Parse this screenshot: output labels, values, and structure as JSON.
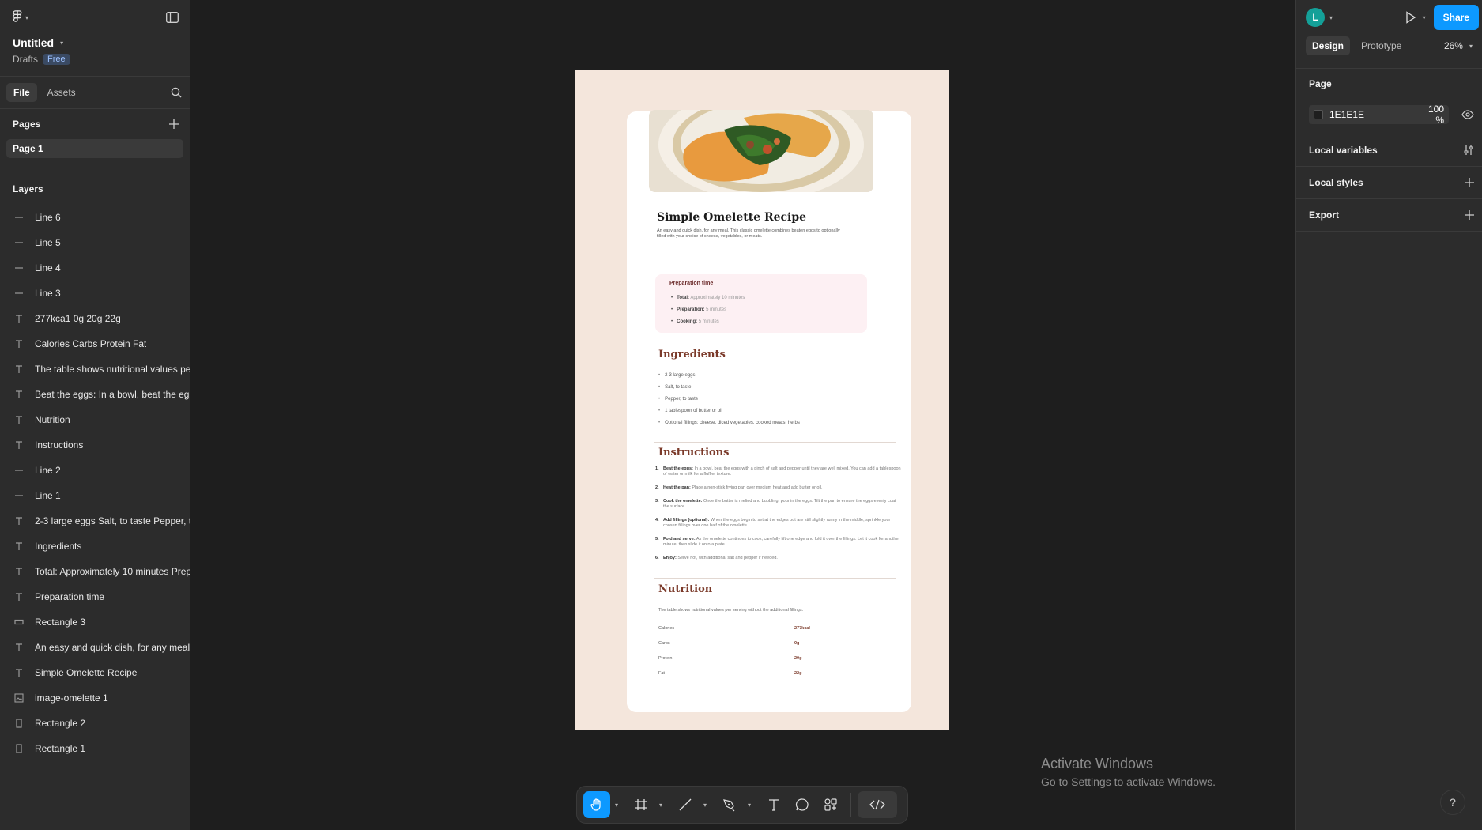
{
  "file": {
    "title": "Untitled",
    "location": "Drafts",
    "plan_badge": "Free"
  },
  "left_tabs": {
    "file": "File",
    "assets": "Assets"
  },
  "pages": {
    "heading": "Pages",
    "items": [
      "Page 1"
    ]
  },
  "layers": {
    "heading": "Layers",
    "items": [
      {
        "name": "Line 6",
        "icon": "line-icon"
      },
      {
        "name": "Line 5",
        "icon": "line-icon"
      },
      {
        "name": "Line 4",
        "icon": "line-icon"
      },
      {
        "name": "Line 3",
        "icon": "line-icon"
      },
      {
        "name": "277kca1 0g 20g 22g",
        "icon": "text-icon"
      },
      {
        "name": "Calories Carbs Protein Fat",
        "icon": "text-icon"
      },
      {
        "name": "The table shows nutritional values per",
        "icon": "text-icon"
      },
      {
        "name": "Beat the eggs: In a bowl, beat the egg",
        "icon": "text-icon"
      },
      {
        "name": "Nutrition",
        "icon": "text-icon"
      },
      {
        "name": "Instructions",
        "icon": "text-icon"
      },
      {
        "name": "Line 2",
        "icon": "line-icon"
      },
      {
        "name": "Line 1",
        "icon": "line-icon"
      },
      {
        "name": "2-3 large eggs Salt, to taste Pepper, to",
        "icon": "text-icon"
      },
      {
        "name": "Ingredients",
        "icon": "text-icon"
      },
      {
        "name": "Total: Approximately 10 minutes Prepa",
        "icon": "text-icon"
      },
      {
        "name": "Preparation time",
        "icon": "text-icon"
      },
      {
        "name": "Rectangle 3",
        "icon": "rectangle-icon"
      },
      {
        "name": "An easy and quick dish, for any meal. T",
        "icon": "text-icon"
      },
      {
        "name": "Simple Omelette Recipe",
        "icon": "text-icon"
      },
      {
        "name": "image-omelette 1",
        "icon": "image-icon"
      },
      {
        "name": "Rectangle 2",
        "icon": "frame-icon"
      },
      {
        "name": "Rectangle 1",
        "icon": "frame-icon"
      }
    ]
  },
  "right": {
    "avatar_initial": "L",
    "share_label": "Share",
    "tabs": {
      "design": "Design",
      "prototype": "Prototype"
    },
    "zoom": "26%",
    "page_heading": "Page",
    "page_color": {
      "hex": "1E1E1E",
      "opacity": "100",
      "unit": "%",
      "swatch": "#1e1e1e"
    },
    "local_variables": "Local variables",
    "local_styles": "Local styles",
    "export": "Export"
  },
  "recipe": {
    "title": "Simple Omelette Recipe",
    "intro": "An easy and quick dish, for any meal. This classic omelette combines beaten eggs to optionally filled with your choice of cheese, vegetables, or meats.",
    "prep": {
      "title": "Preparation time",
      "items": [
        {
          "label": "Total:",
          "value": "Approximately 10 minutes"
        },
        {
          "label": "Preparation:",
          "value": "5 minutes"
        },
        {
          "label": "Cooking:",
          "value": "5 minutes"
        }
      ]
    },
    "ingredients": {
      "title": "Ingredients",
      "items": [
        "2-3 large eggs",
        "Salt, to taste",
        "Pepper, to taste",
        "1 tablespoon of butter or oil",
        "Optional fillings: cheese, diced vegetables, cooked meats, herbs"
      ]
    },
    "instructions": {
      "title": "Instructions",
      "items": [
        {
          "n": "1.",
          "label": "Beat the eggs:",
          "text": "In a bowl, beat the eggs with a pinch of salt and pepper until they are well mixed. You can add a tablespoon of water or milk for a fluffier texture."
        },
        {
          "n": "2.",
          "label": "Heat the pan:",
          "text": "Place a non-stick frying pan over medium heat and add butter or oil."
        },
        {
          "n": "3.",
          "label": "Cook the omelette:",
          "text": "Once the butter is melted and bubbling, pour in the eggs. Tilt the pan to ensure the eggs evenly coat the surface."
        },
        {
          "n": "4.",
          "label": "Add fillings (optional):",
          "text": "When the eggs begin to set at the edges but are still slightly runny in the middle, sprinkle your chosen fillings over one half of the omelette."
        },
        {
          "n": "5.",
          "label": "Fold and serve:",
          "text": "As the omelette continues to cook, carefully lift one edge and fold it over the fillings. Let it cook for another minute, then slide it onto a plate."
        },
        {
          "n": "6.",
          "label": "Enjoy:",
          "text": "Serve hot, with additional salt and pepper if needed."
        }
      ]
    },
    "nutrition": {
      "title": "Nutrition",
      "desc": "The table shows nutritional values per serving without the additional fillings.",
      "rows": [
        {
          "k": "Calories",
          "v": "277kcal"
        },
        {
          "k": "Carbs",
          "v": "0g"
        },
        {
          "k": "Protein",
          "v": "20g"
        },
        {
          "k": "Fat",
          "v": "22g"
        }
      ]
    }
  },
  "watermark": {
    "line1": "Activate Windows",
    "line2": "Go to Settings to activate Windows."
  },
  "help_label": "?"
}
